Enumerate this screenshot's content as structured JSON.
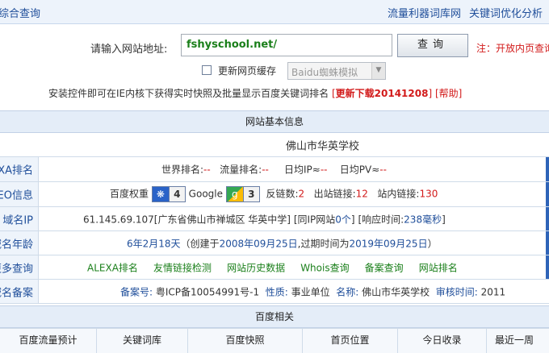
{
  "topbar": {
    "title": "综合查询",
    "links": [
      "流量利器词库网",
      "关键词优化分析"
    ]
  },
  "query": {
    "label": "请输入网站地址:",
    "url_value": "fshyschool.net/",
    "button_label": "查询",
    "note": "注：开放内页查询"
  },
  "cache": {
    "checkbox_label": "更新网页缓存",
    "select_value": "Baidu蜘蛛模拟"
  },
  "install": {
    "text": "安装控件即可在IE内核下获得实时快照及批量显示百度关键词排名",
    "download_label": "更新下载20141208",
    "help_label": "帮助"
  },
  "basic": {
    "header": "网站基本信息",
    "site_name": "佛山市华英学校",
    "rows": {
      "alexa": {
        "label": "ALEXA排名",
        "world_label": "世界排名:",
        "world_value": "--",
        "traffic_label": "流量排名:",
        "traffic_value": "--",
        "ip_label": "日均IP≈",
        "ip_value": "--",
        "pv_label": "日均PV≈",
        "pv_value": "--"
      },
      "seo": {
        "label": "SEO信息",
        "baidu_weight_label": "百度权重",
        "baidu_weight": "4",
        "google_label": "Google",
        "google_pr": "3",
        "backlinks_label": "反链数:",
        "backlinks": "2",
        "outbound_label": "出站链接:",
        "outbound": "12",
        "inbound_label": "站内链接:",
        "inbound": "130"
      },
      "ip": {
        "label": "域名IP",
        "ip": "61.145.69.107",
        "location": "[广东省佛山市禅城区 华英中学]",
        "same_ip_open": "[同IP网站",
        "same_ip_count": "0个",
        "same_ip_close": "]",
        "resp_open": "[响应时间:",
        "resp_value": "238毫秒",
        "resp_close": "]"
      },
      "age": {
        "label": "域名年龄",
        "age_value": "6年2月18天",
        "created_prefix": "（创建于",
        "created_date": "2008年09月25日",
        "expire_prefix": ",过期时间为",
        "expire_date": "2019年09月25日",
        "suffix": "）"
      },
      "more": {
        "label": "更多查询",
        "links": [
          "ALEXA排名",
          "友情链接检测",
          "网站历史数据",
          "Whois查询",
          "备案查询",
          "网站排名"
        ]
      },
      "beian": {
        "label": "域名备案",
        "no_label": "备案号:",
        "no_value": "粤ICP备10054991号-1",
        "nature_label": "性质:",
        "nature_value": "事业单位",
        "name_label": "名称:",
        "name_value": "佛山市华英学校",
        "audit_label": "审核时间:",
        "audit_value": "2011"
      }
    }
  },
  "baidu": {
    "header": "百度相关",
    "columns": [
      "百度流量预计",
      "关键词库",
      "百度快照",
      "首页位置",
      "今日收录",
      "最近一周"
    ]
  },
  "colors": {
    "accent": "#1f4e9a",
    "alert": "#d21a1a",
    "link_green": "#1a7f1a",
    "panel_bg": "#e4edf8"
  }
}
